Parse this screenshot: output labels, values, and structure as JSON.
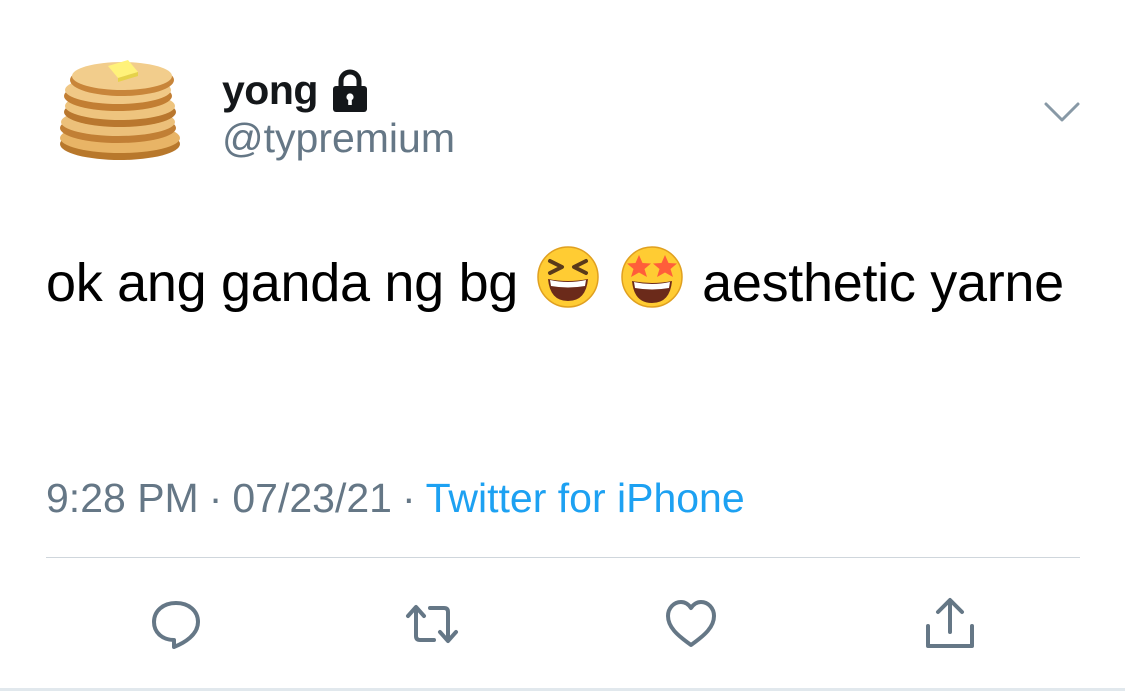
{
  "user": {
    "display_name": "yong",
    "handle": "@typremium",
    "avatar_icon": "pancake-stack",
    "protected_icon": "lock-icon"
  },
  "tweet": {
    "text_part1": "ok ang ganda ng bg",
    "emojis": [
      "grinning-squinting-face",
      "star-struck-face"
    ],
    "text_part2": "aesthetic yarne"
  },
  "meta": {
    "time": "9:28 PM",
    "separator": "·",
    "date": "07/23/21",
    "source": "Twitter for iPhone"
  },
  "actions": [
    "reply-icon",
    "retweet-icon",
    "like-icon",
    "share-icon"
  ],
  "colors": {
    "text": "#14171a",
    "secondary": "#657786",
    "link": "#1da1f2",
    "divider": "#cfd6dc"
  }
}
